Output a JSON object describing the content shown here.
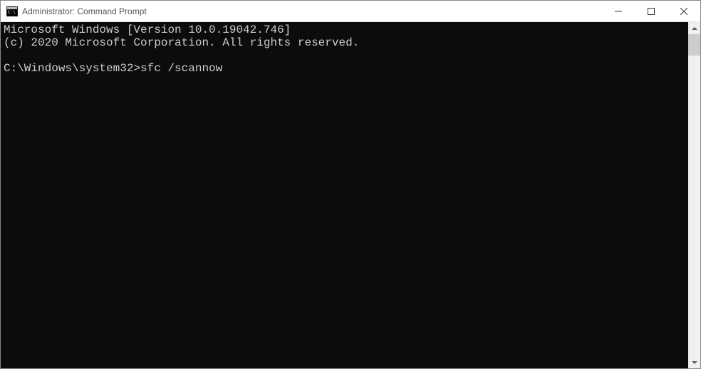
{
  "window": {
    "title": "Administrator: Command Prompt"
  },
  "terminal": {
    "line1": "Microsoft Windows [Version 10.0.19042.746]",
    "line2": "(c) 2020 Microsoft Corporation. All rights reserved.",
    "blank": "",
    "prompt": "C:\\Windows\\system32>",
    "command": "sfc /scannow"
  }
}
